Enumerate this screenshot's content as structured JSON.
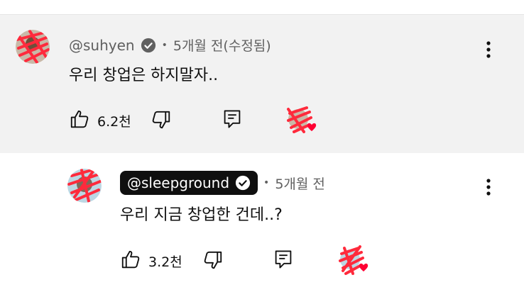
{
  "top_comment": {
    "author": "@suhyen",
    "time": "5개월 전(수정됨)",
    "text": "우리 창업은 하지말자..",
    "likes": "6.2천"
  },
  "reply": {
    "author": "@sleepground",
    "time": "5개월 전",
    "text": "우리 지금 창업한 건데..?",
    "likes": "3.2천"
  },
  "separator": "•",
  "icons": {
    "like": "thumb-up-icon",
    "dislike": "thumb-down-icon",
    "reply": "reply-icon",
    "verified": "verified-check-icon",
    "more": "more-vert-icon",
    "creator_heart": "creator-heart-icon"
  },
  "colors": {
    "highlight_bg": "#f2f2f2",
    "heart": "#ff0033",
    "badge_bg": "#0f0f0f",
    "scribble": "#ff2a3c"
  }
}
